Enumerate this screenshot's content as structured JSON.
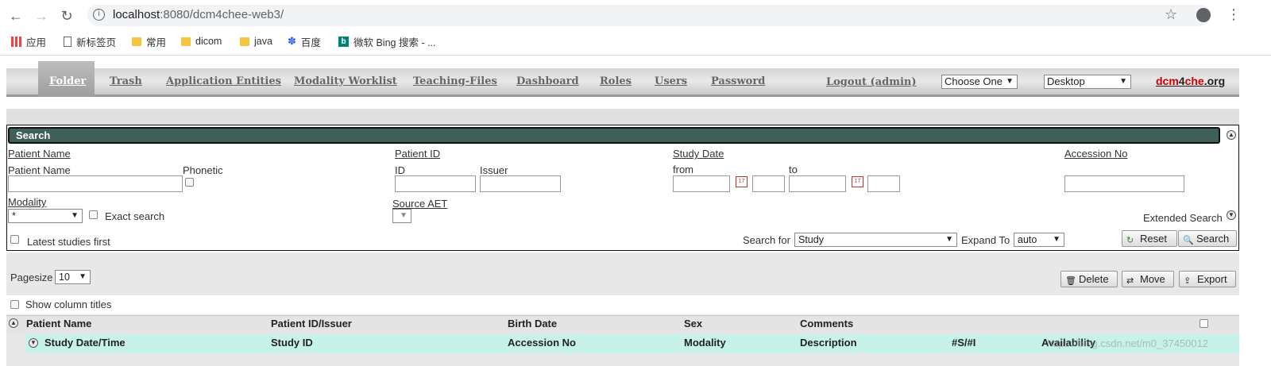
{
  "browser": {
    "url_host": "localhost",
    "url_rest": ":8080/dcm4chee-web3/",
    "bookmarks": [
      "应用",
      "新标签页",
      "常用",
      "dicom",
      "java",
      "百度",
      "微软 Bing 搜索 - ..."
    ]
  },
  "nav": {
    "items": [
      "Folder",
      "Trash",
      "Application Entities",
      "Modality Worklist",
      "Teaching-Files",
      "Dashboard",
      "Roles",
      "Users",
      "Password"
    ],
    "logout": "Logout (admin)",
    "choose_one": "Choose One",
    "desktop": "Desktop",
    "brand_a": "dcm",
    "brand_b": "4",
    "brand_c": "che",
    "brand_d": ".org"
  },
  "search": {
    "title": "Search",
    "patient_name_heading": "Patient Name",
    "patient_name_label": "Patient Name",
    "phonetic_label": "Phonetic",
    "patient_id_heading": "Patient ID",
    "id_label": "ID",
    "issuer_label": "Issuer",
    "study_date_heading": "Study Date",
    "from_label": "from",
    "to_label": "to",
    "accession_heading": "Accession No",
    "modality_heading": "Modality",
    "modality_value": "*",
    "exact_search_label": "Exact search",
    "source_aet_heading": "Source AET",
    "extended_search_label": "Extended Search",
    "latest_first_label": "Latest studies first",
    "search_for_label": "Search for",
    "search_for_value": "Study",
    "expand_to_label": "Expand To",
    "expand_to_value": "auto",
    "reset_label": "Reset",
    "search_label": "Search"
  },
  "results": {
    "pagesize_label": "Pagesize",
    "pagesize_value": "10",
    "delete_label": "Delete",
    "move_label": "Move",
    "export_label": "Export",
    "show_titles_label": "Show column titles",
    "patient_columns": [
      "Patient Name",
      "Patient ID/Issuer",
      "Birth Date",
      "Sex",
      "Comments"
    ],
    "study_columns": [
      "Study Date/Time",
      "Study ID",
      "Accession No",
      "Modality",
      "Description",
      "#S/#I",
      "Availability"
    ]
  },
  "watermark": "https://blog.csdn.net/m0_37450012"
}
